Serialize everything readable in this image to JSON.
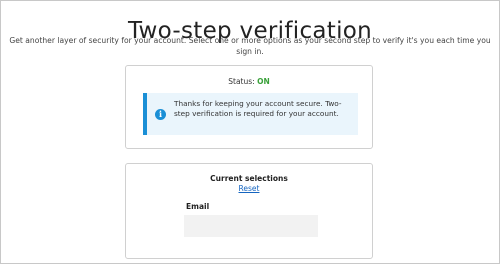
{
  "header": {
    "title": "Two-step verification",
    "subtitle": "Get another layer of security for your account. Select one or more options as your second step to verify it's you each time you sign in."
  },
  "status": {
    "label": "Status:",
    "value": "ON",
    "value_color": "#3aa13a"
  },
  "info": {
    "icon": "info-icon",
    "glyph": "i",
    "message": "Thanks for keeping your account secure. Two-step verification is required for your account.",
    "accent_color": "#1a8fd6"
  },
  "selections": {
    "heading": "Current selections",
    "reset_label": "Reset",
    "email_label": "Email"
  }
}
